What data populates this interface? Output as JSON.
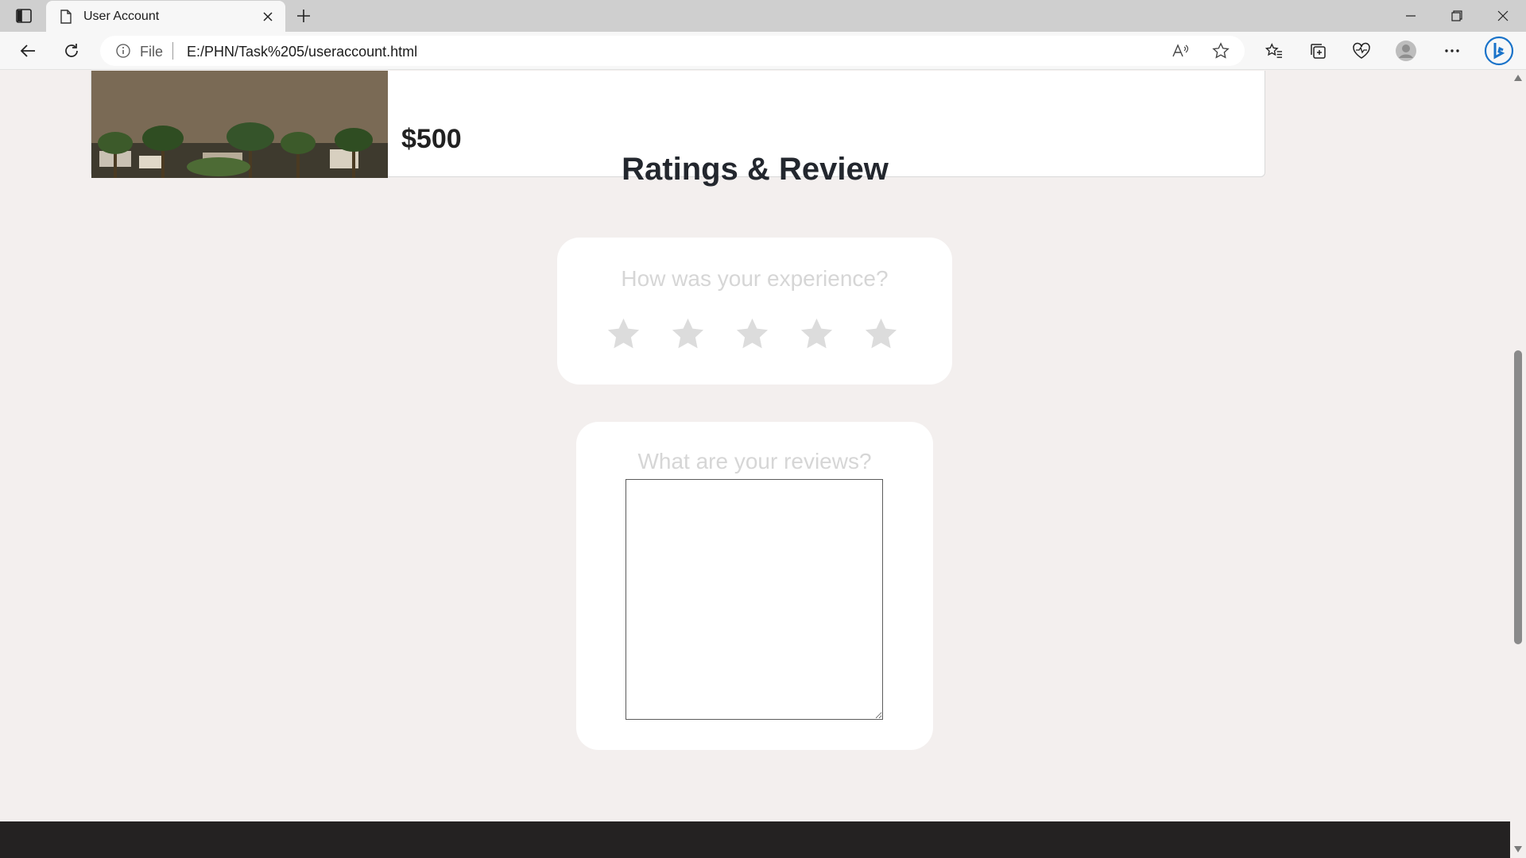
{
  "browser": {
    "tab": {
      "title": "User Account",
      "icon": "page-icon"
    },
    "address": {
      "scheme_label": "File",
      "url": "E:/PHN/Task%205/useraccount.html"
    },
    "icons": [
      "sidebar-toggle-icon",
      "close-icon",
      "plus-icon",
      "minimize-icon",
      "restore-icon",
      "back-arrow-icon",
      "refresh-icon",
      "info-icon",
      "read-aloud-icon",
      "star-icon",
      "favorites-icon",
      "collections-icon",
      "browser-essentials-icon",
      "profile-icon",
      "more-icon",
      "bing-chat-icon"
    ]
  },
  "page": {
    "booking": {
      "price": "$500"
    },
    "section_title": "Ratings & Review",
    "rating": {
      "question": "How was your experience?",
      "stars_selected": 0,
      "star_count": 5
    },
    "review": {
      "question": "What are your reviews?",
      "value": ""
    }
  },
  "colors": {
    "page_bg": "#f3efee",
    "card_bg": "#ffffff",
    "heading": "#23272e",
    "muted_text": "#d6d6d6",
    "star_inactive": "#dcdcdc",
    "footer_bg": "#242222"
  }
}
